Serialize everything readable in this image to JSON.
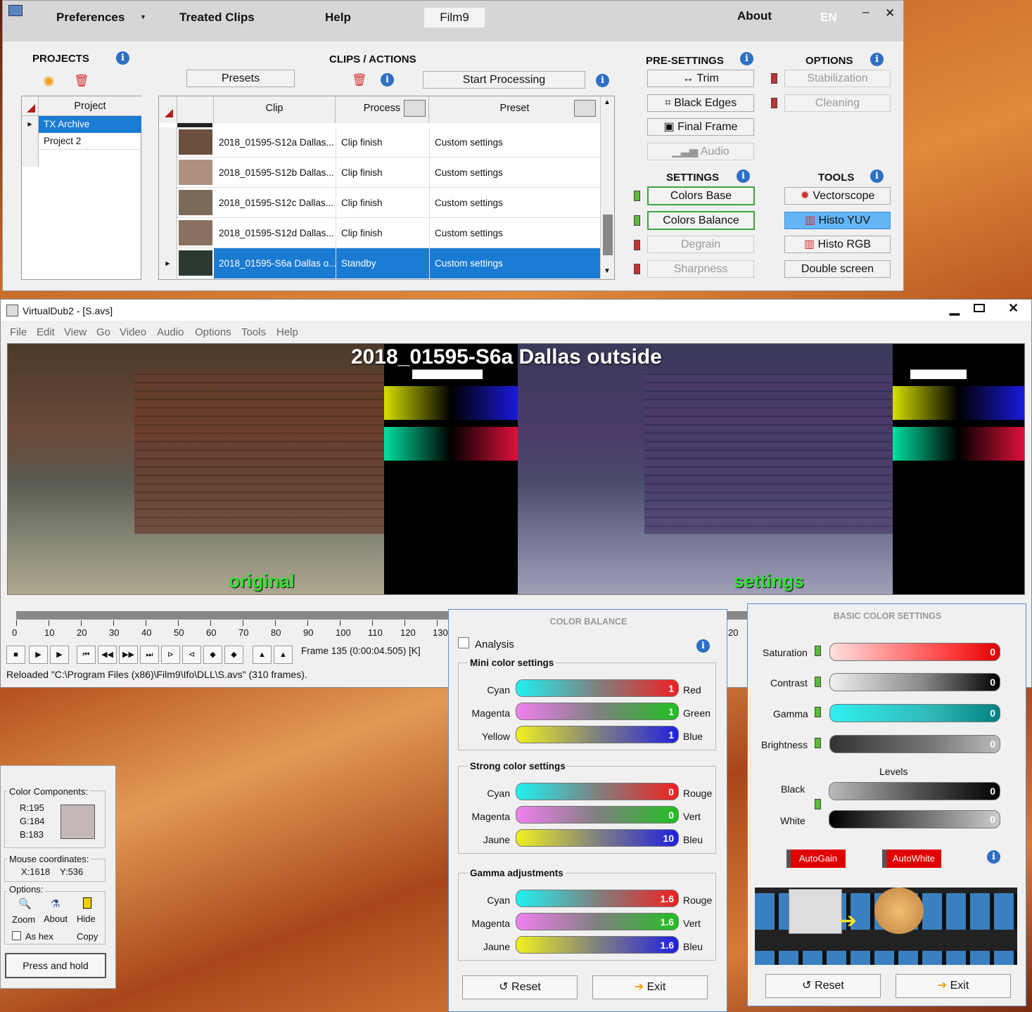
{
  "film9": {
    "menu": {
      "preferences": "Preferences",
      "treated_clips": "Treated Clips",
      "help": "Help",
      "film9": "Film9",
      "about": "About",
      "lang": "EN",
      "minimize": "–",
      "close": "✕"
    },
    "projects": {
      "title": "PROJECTS",
      "col": "Project",
      "rows": [
        "TX Archive",
        "Project 2"
      ]
    },
    "clips": {
      "title": "CLIPS / ACTIONS",
      "presets": "Presets",
      "start": "Start Processing",
      "headers": {
        "clip": "Clip",
        "process": "Process",
        "preset": "Preset"
      },
      "rows": [
        {
          "clip": "2018_01595-S12a  Dallas...",
          "process": "Clip finish",
          "preset": "Custom settings"
        },
        {
          "clip": "2018_01595-S12b  Dallas...",
          "process": "Clip finish",
          "preset": "Custom settings"
        },
        {
          "clip": "2018_01595-S12c  Dallas...",
          "process": "Clip finish",
          "preset": "Custom settings"
        },
        {
          "clip": "2018_01595-S12d  Dallas...",
          "process": "Clip finish",
          "preset": "Custom settings"
        },
        {
          "clip": "2018_01595-S6a Dallas o...",
          "process": "Standby",
          "preset": "Custom settings"
        }
      ]
    },
    "presettings": {
      "title": "PRE-SETTINGS",
      "trim": "Trim",
      "black_edges": "Black Edges",
      "final_frame": "Final Frame",
      "audio": "Audio"
    },
    "options": {
      "title": "OPTIONS",
      "stabilization": "Stabilization",
      "cleaning": "Cleaning"
    },
    "settings": {
      "title": "SETTINGS",
      "colors_base": "Colors Base",
      "colors_balance": "Colors Balance",
      "degrain": "Degrain",
      "sharpness": "Sharpness"
    },
    "tools": {
      "title": "TOOLS",
      "vectorscope": "Vectorscope",
      "histo_yuv": "Histo YUV",
      "histo_rgb": "Histo RGB",
      "double_screen": "Double screen"
    }
  },
  "vdub": {
    "title": "VirtualDub2  - [S.avs]",
    "menu": [
      "File",
      "Edit",
      "View",
      "Go",
      "Video",
      "Audio",
      "Options",
      "Tools",
      "Help"
    ],
    "overlay_title": "2018_01595-S6a Dallas outside",
    "label_original": "original",
    "label_settings": "settings",
    "ticks": [
      "0",
      "10",
      "20",
      "30",
      "40",
      "50",
      "60",
      "70",
      "80",
      "90",
      "100",
      "110",
      "120",
      "130"
    ],
    "tick_tail": "20",
    "frame": "Frame 135 (0:00:04.505) [K]",
    "status": "Reloaded \"C:\\Program Files (x86)\\Film9\\Ifo\\DLL\\S.avs\" (310 frames)."
  },
  "color_balance": {
    "title": "COLOR BALANCE",
    "analysis": "Analysis",
    "mini": {
      "title": "Mini color settings",
      "rows": [
        {
          "l": "Cyan",
          "r": "Red",
          "v": "1"
        },
        {
          "l": "Magenta",
          "r": "Green",
          "v": "1"
        },
        {
          "l": "Yellow",
          "r": "Blue",
          "v": "1"
        }
      ]
    },
    "strong": {
      "title": "Strong color settings",
      "rows": [
        {
          "l": "Cyan",
          "r": "Rouge",
          "v": "0"
        },
        {
          "l": "Magenta",
          "r": "Vert",
          "v": "0"
        },
        {
          "l": "Jaune",
          "r": "Bleu",
          "v": "10"
        }
      ]
    },
    "gamma": {
      "title": "Gamma adjustments",
      "rows": [
        {
          "l": "Cyan",
          "r": "Rouge",
          "v": "1.6"
        },
        {
          "l": "Magenta",
          "r": "Vert",
          "v": "1.6"
        },
        {
          "l": "Jaune",
          "r": "Bleu",
          "v": "1.6"
        }
      ]
    },
    "reset": "Reset",
    "exit": "Exit"
  },
  "basic": {
    "title": "BASIC COLOR SETTINGS",
    "saturation": "Saturation",
    "sat_v": "0",
    "contrast": "Contrast",
    "con_v": "0",
    "gamma": "Gamma",
    "gam_v": "0",
    "brightness": "Brightness",
    "bri_v": "0",
    "levels": "Levels",
    "black": "Black",
    "black_v": "0",
    "white": "White",
    "white_v": "0",
    "autogain": "AutoGain",
    "autowhite": "AutoWhite",
    "reset": "Reset",
    "exit": "Exit"
  },
  "picker": {
    "components_title": "Color Components:",
    "r": "R:195",
    "g": "G:184",
    "b": "B:183",
    "swatch": "#c3b8b7",
    "mouse_title": "Mouse coordinates:",
    "x": "X:1618",
    "y": "Y:536",
    "options_title": "Options:",
    "zoom": "Zoom",
    "about": "About",
    "hide": "Hide",
    "as_hex": "As hex",
    "copy": "Copy",
    "press": "Press and hold"
  }
}
